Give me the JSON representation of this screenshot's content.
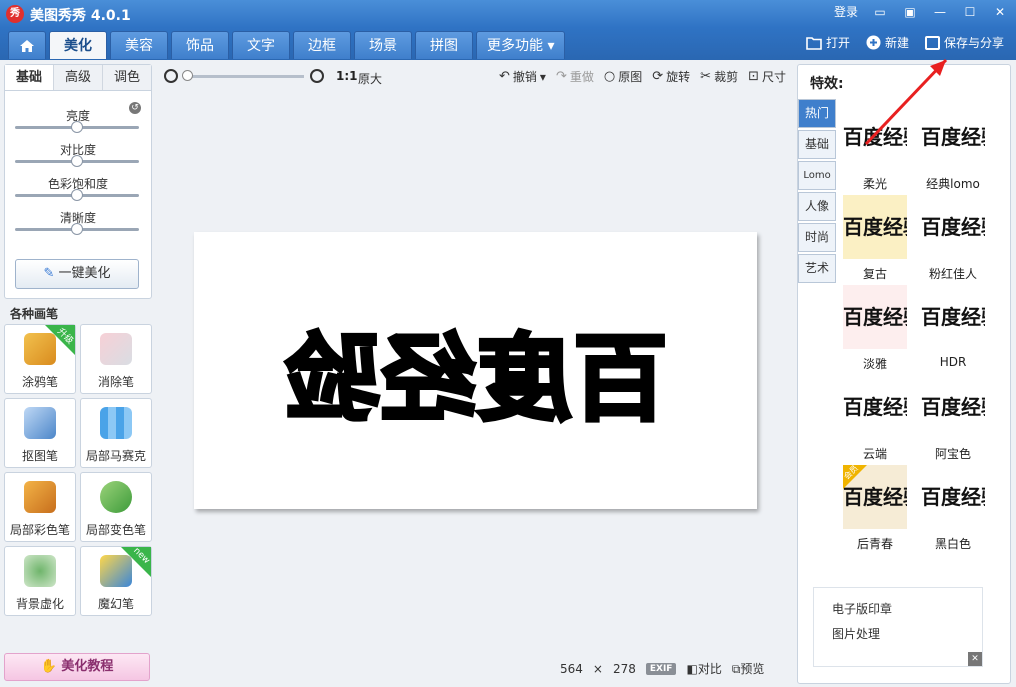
{
  "app": {
    "title": "美图秀秀 4.0.1",
    "logo_text": "秀",
    "login": "登录"
  },
  "tabs": [
    {
      "label": "美化"
    },
    {
      "label": "美容"
    },
    {
      "label": "饰品"
    },
    {
      "label": "文字"
    },
    {
      "label": "边框"
    },
    {
      "label": "场景"
    },
    {
      "label": "拼图"
    },
    {
      "label": "更多功能 ▾"
    }
  ],
  "top_actions": {
    "open": "打开",
    "new": "新建",
    "save": "保存与分享"
  },
  "left": {
    "tabs": [
      "基础",
      "高级",
      "调色"
    ],
    "sliders": [
      {
        "label": "亮度",
        "value": 0.5
      },
      {
        "label": "对比度",
        "value": 0.5
      },
      {
        "label": "色彩饱和度",
        "value": 0.5
      },
      {
        "label": "清晰度",
        "value": 0.5
      }
    ],
    "one_key": "一键美化",
    "brush_title": "各种画笔",
    "brushes": [
      {
        "label": "涂鸦笔",
        "badge": "升级"
      },
      {
        "label": "消除笔",
        "badge": ""
      },
      {
        "label": "抠图笔",
        "badge": ""
      },
      {
        "label": "局部马赛克",
        "badge": ""
      },
      {
        "label": "局部彩色笔",
        "badge": ""
      },
      {
        "label": "局部变色笔",
        "badge": ""
      },
      {
        "label": "背景虚化",
        "badge": ""
      },
      {
        "label": "魔幻笔",
        "badge": "new"
      }
    ],
    "tutorial": "美化教程"
  },
  "editor": {
    "zoom_ratio": "1:1",
    "original_size": "原大",
    "undo": "撤销",
    "redo": "重做",
    "original": "原图",
    "rotate": "旋转",
    "crop": "裁剪",
    "resize": "尺寸",
    "canvas_text": "百度经验"
  },
  "status": {
    "width": "564",
    "x": "×",
    "height": "278",
    "exif": "EXIF",
    "compare": "对比",
    "preview": "预览"
  },
  "right": {
    "title": "特效:",
    "categories": [
      "热门",
      "基础",
      "Lomo",
      "人像",
      "时尚",
      "艺术"
    ],
    "thumb_text": "百度经验",
    "effects": [
      {
        "label": "柔光",
        "bg": "#ffffff"
      },
      {
        "label": "经典lomo",
        "bg": "#ffffff"
      },
      {
        "label": "复古",
        "bg": "#fbf0c4"
      },
      {
        "label": "粉红佳人",
        "bg": "#ffffff"
      },
      {
        "label": "淡雅",
        "bg": "#fdeeee"
      },
      {
        "label": "HDR",
        "bg": "#ffffff"
      },
      {
        "label": "云端",
        "bg": "#ffffff"
      },
      {
        "label": "阿宝色",
        "bg": "#ffffff"
      },
      {
        "label": "后青春",
        "bg": "#f6ecd6"
      },
      {
        "label": "黑白色",
        "bg": "#ffffff"
      }
    ],
    "vip_badge": "会员"
  },
  "ad": {
    "items": [
      "电子版印章",
      "图片处理"
    ],
    "close": "✕"
  }
}
